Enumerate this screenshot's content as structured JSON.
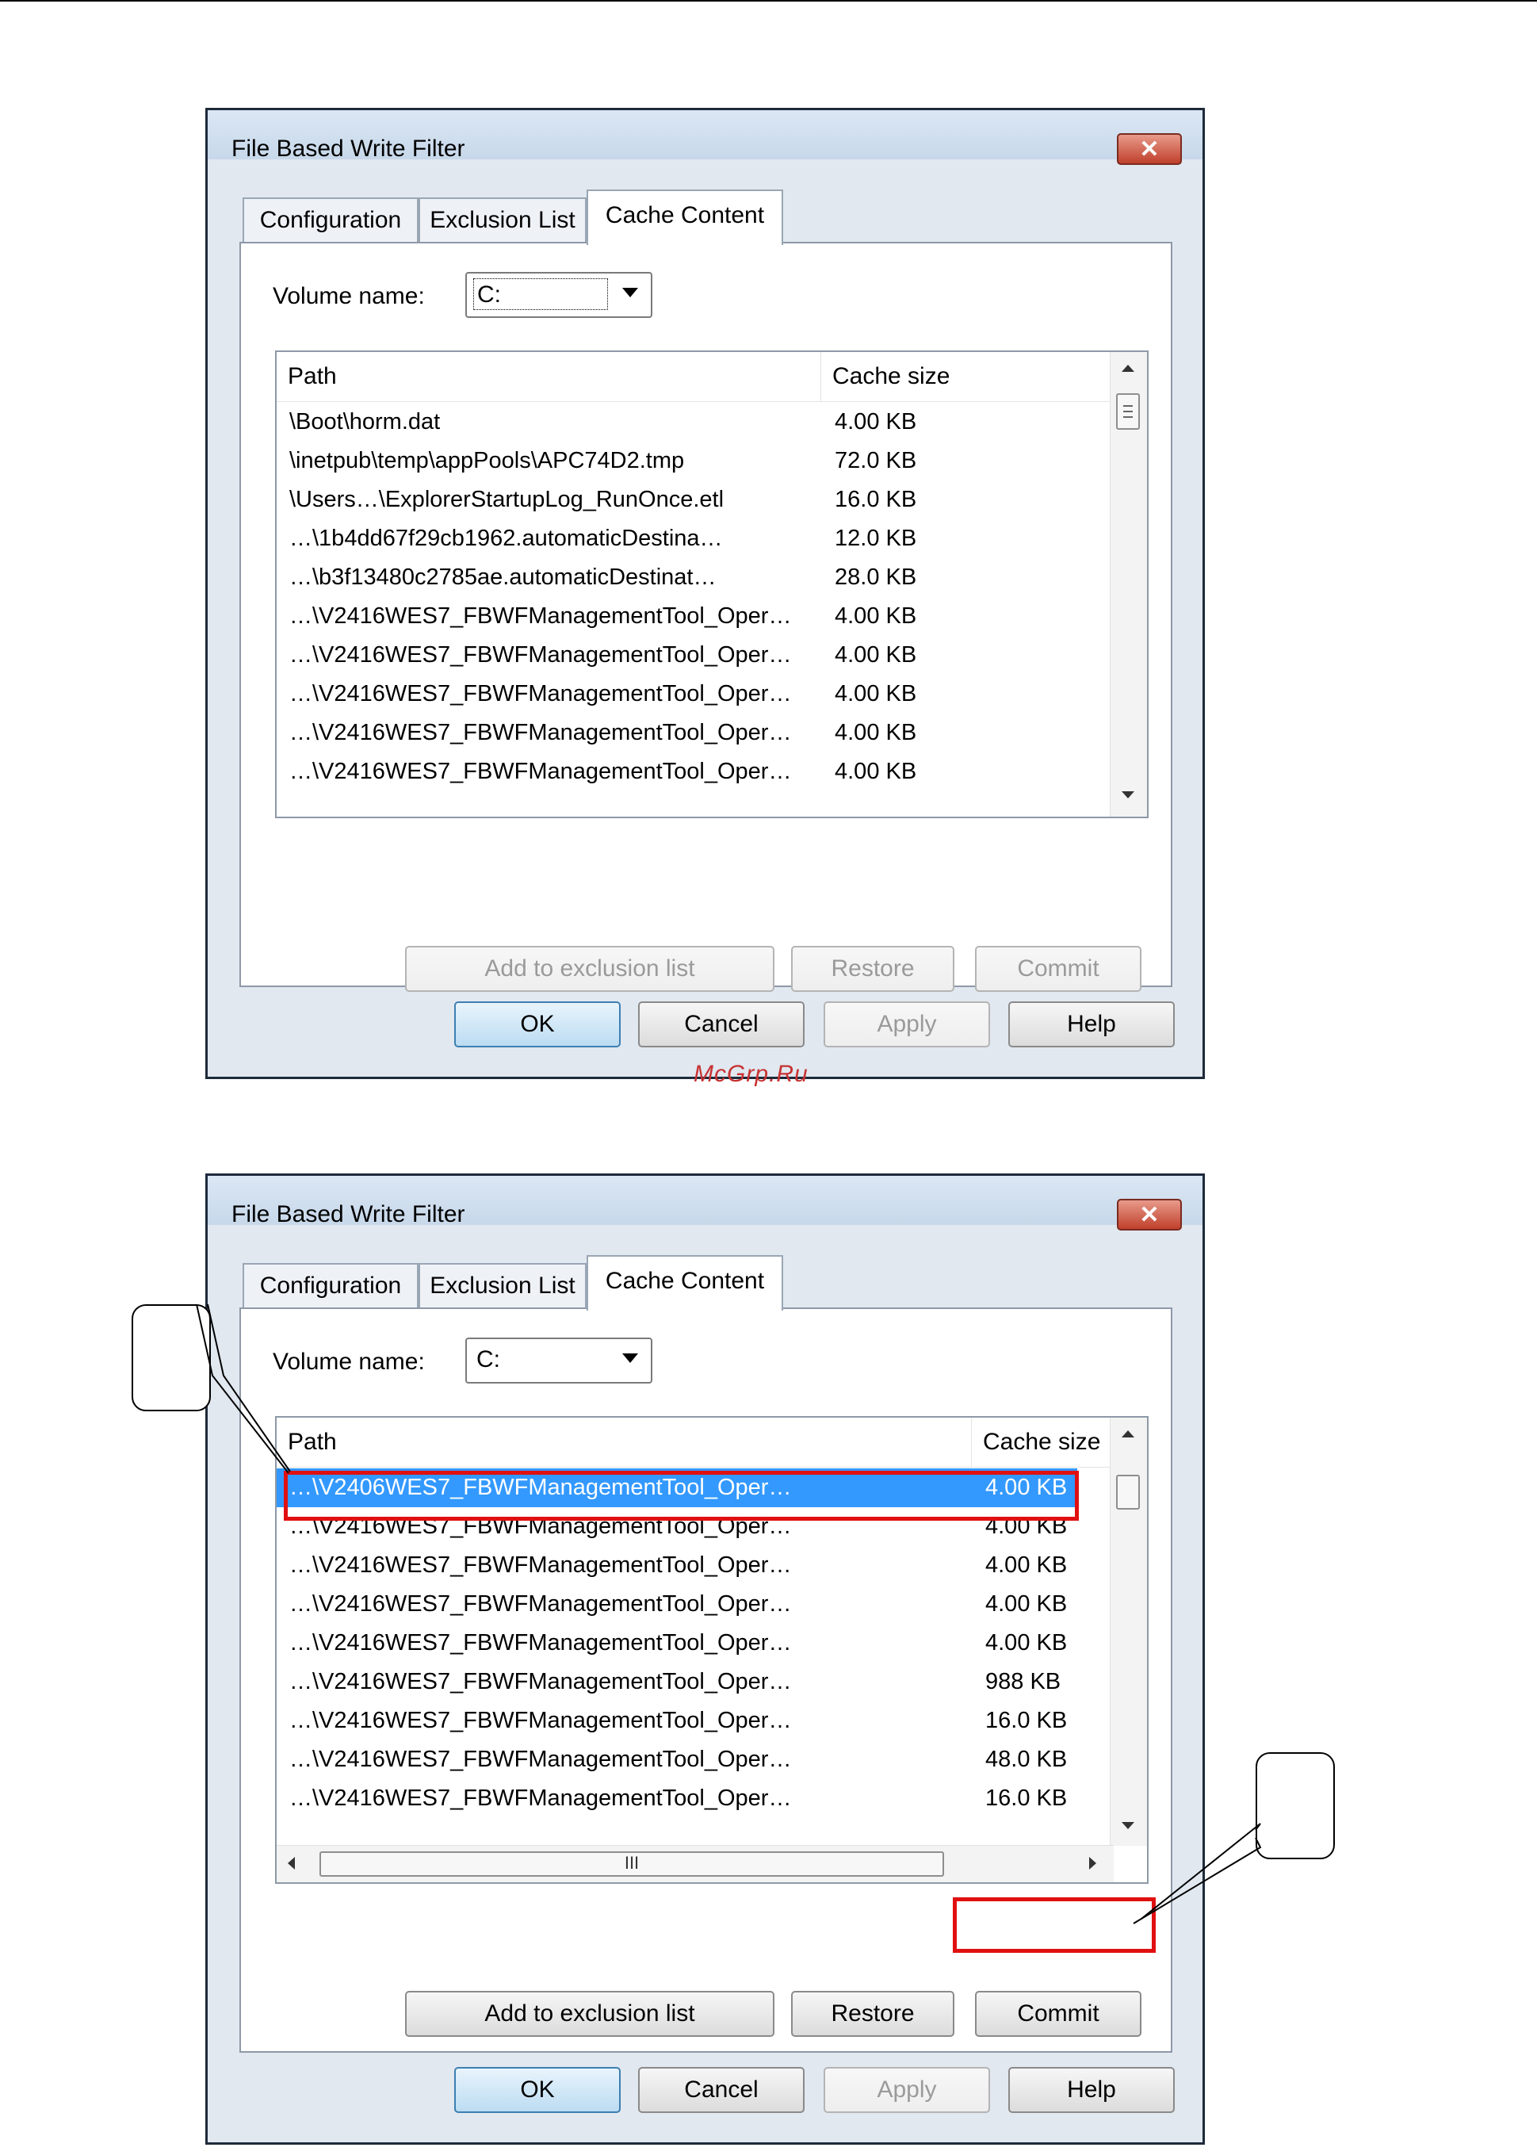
{
  "dialogs": [
    {
      "title": "File Based Write Filter",
      "close_glyph": "✕",
      "tabs": [
        "Configuration",
        "Exclusion List",
        "Cache Content"
      ],
      "active_tab": "Cache Content",
      "volume_label": "Volume name:",
      "volume_value": "C:",
      "columns": {
        "path": "Path",
        "size": "Cache size"
      },
      "rows": [
        {
          "path": "\\Boot\\horm.dat",
          "size": "4.00 KB"
        },
        {
          "path": "\\inetpub\\temp\\appPools\\APC74D2.tmp",
          "size": "72.0 KB"
        },
        {
          "path": "\\Users…\\ExplorerStartupLog_RunOnce.etl",
          "size": "16.0 KB"
        },
        {
          "path": "…\\1b4dd67f29cb1962.automaticDestina…",
          "size": "12.0 KB"
        },
        {
          "path": "…\\b3f13480c2785ae.automaticDestinat…",
          "size": "28.0 KB"
        },
        {
          "path": "…\\V2416WES7_FBWFManagementTool_Oper…",
          "size": "4.00 KB"
        },
        {
          "path": "…\\V2416WES7_FBWFManagementTool_Oper…",
          "size": "4.00 KB"
        },
        {
          "path": "…\\V2416WES7_FBWFManagementTool_Oper…",
          "size": "4.00 KB"
        },
        {
          "path": "…\\V2416WES7_FBWFManagementTool_Oper…",
          "size": "4.00 KB"
        },
        {
          "path": "…\\V2416WES7_FBWFManagementTool_Oper…",
          "size": "4.00 KB"
        }
      ],
      "selected_row": null,
      "action_buttons": {
        "add": "Add to exclusion list",
        "restore": "Restore",
        "commit": "Commit",
        "enabled": false
      },
      "footer_buttons": {
        "ok": "OK",
        "cancel": "Cancel",
        "apply": "Apply",
        "help": "Help"
      }
    },
    {
      "title": "File Based Write Filter",
      "close_glyph": "✕",
      "tabs": [
        "Configuration",
        "Exclusion List",
        "Cache Content"
      ],
      "active_tab": "Cache Content",
      "volume_label": "Volume name:",
      "volume_value": "C:",
      "columns": {
        "path": "Path",
        "size": "Cache size"
      },
      "rows": [
        {
          "path": "…\\V2406WES7_FBWFManagementTool_Oper…",
          "size": "4.00 KB"
        },
        {
          "path": "…\\V2416WES7_FBWFManagementTool_Oper…",
          "size": "4.00 KB"
        },
        {
          "path": "…\\V2416WES7_FBWFManagementTool_Oper…",
          "size": "4.00 KB"
        },
        {
          "path": "…\\V2416WES7_FBWFManagementTool_Oper…",
          "size": "4.00 KB"
        },
        {
          "path": "…\\V2416WES7_FBWFManagementTool_Oper…",
          "size": "4.00 KB"
        },
        {
          "path": "…\\V2416WES7_FBWFManagementTool_Oper…",
          "size": "988 KB"
        },
        {
          "path": "…\\V2416WES7_FBWFManagementTool_Oper…",
          "size": "16.0 KB"
        },
        {
          "path": "…\\V2416WES7_FBWFManagementTool_Oper…",
          "size": "48.0 KB"
        },
        {
          "path": "…\\V2416WES7_FBWFManagementTool_Oper…",
          "size": "16.0 KB"
        }
      ],
      "selected_row": 0,
      "hscroll_grip": "III",
      "action_buttons": {
        "add": "Add to exclusion list",
        "restore": "Restore",
        "commit": "Commit",
        "enabled": true
      },
      "footer_buttons": {
        "ok": "OK",
        "cancel": "Cancel",
        "apply": "Apply",
        "help": "Help"
      }
    }
  ],
  "watermark": "McGrp.Ru",
  "colors": {
    "selection": "#3399ff",
    "highlight": "#e01010",
    "watermark": "#c83232"
  }
}
